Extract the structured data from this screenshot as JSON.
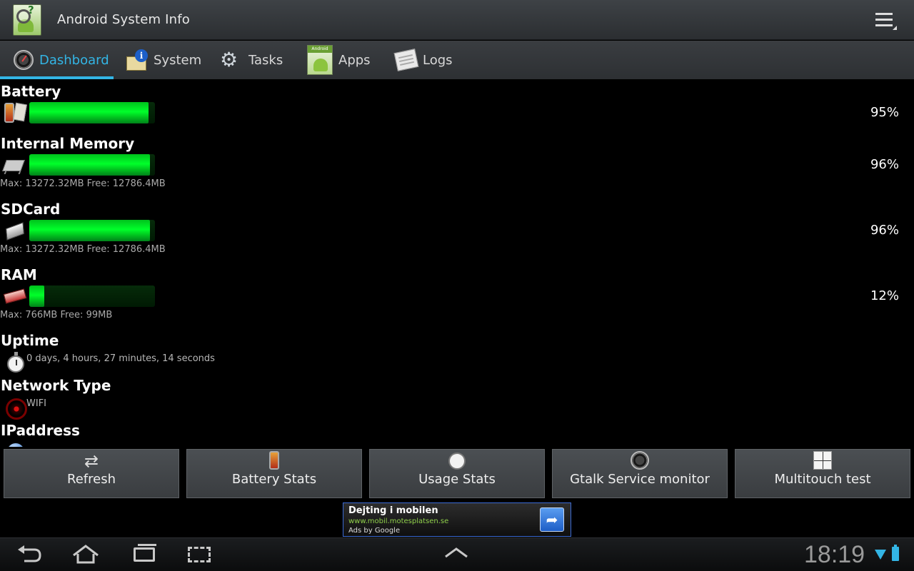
{
  "app": {
    "title": "Android System Info"
  },
  "tabs": [
    {
      "label": "Dashboard",
      "icon": "gauge-icon",
      "active": true
    },
    {
      "label": "System",
      "icon": "info-icon",
      "active": false
    },
    {
      "label": "Tasks",
      "icon": "gears-icon",
      "active": false
    },
    {
      "label": "Apps",
      "icon": "android-apps-icon",
      "active": false
    },
    {
      "label": "Logs",
      "icon": "logs-icon",
      "active": false
    }
  ],
  "dashboard": {
    "battery": {
      "title": "Battery",
      "percent": 95,
      "percent_label": "95%"
    },
    "internal_memory": {
      "title": "Internal Memory",
      "percent": 96,
      "percent_label": "96%",
      "detail": "Max: 13272.32MB Free: 12786.4MB"
    },
    "sdcard": {
      "title": "SDCard",
      "percent": 96,
      "percent_label": "96%",
      "detail": "Max: 13272.32MB Free: 12786.4MB"
    },
    "ram": {
      "title": "RAM",
      "percent": 12,
      "percent_label": "12%",
      "detail": "Max: 766MB Free: 99MB"
    },
    "uptime": {
      "title": "Uptime",
      "value": "0 days, 4 hours, 27 minutes, 14 seconds"
    },
    "network": {
      "title": "Network Type",
      "value": "WIFI"
    },
    "ip": {
      "title": "IPaddress"
    }
  },
  "buttons": [
    {
      "label": "Refresh",
      "icon": "refresh-icon"
    },
    {
      "label": "Battery Stats",
      "icon": "battery-icon"
    },
    {
      "label": "Usage Stats",
      "icon": "stopwatch-icon"
    },
    {
      "label": "Gtalk Service monitor",
      "icon": "gauge-icon"
    },
    {
      "label": "Multitouch test",
      "icon": "graph-icon"
    }
  ],
  "ad": {
    "title": "Dejting i mobilen",
    "url": "www.mobil.motesplatsen.se",
    "by": "Ads by Google"
  },
  "status": {
    "time": "18:19"
  },
  "colors": {
    "accent": "#33b5e5",
    "bar_green": "#00ff2a",
    "ad_url": "#8fcf4a"
  }
}
